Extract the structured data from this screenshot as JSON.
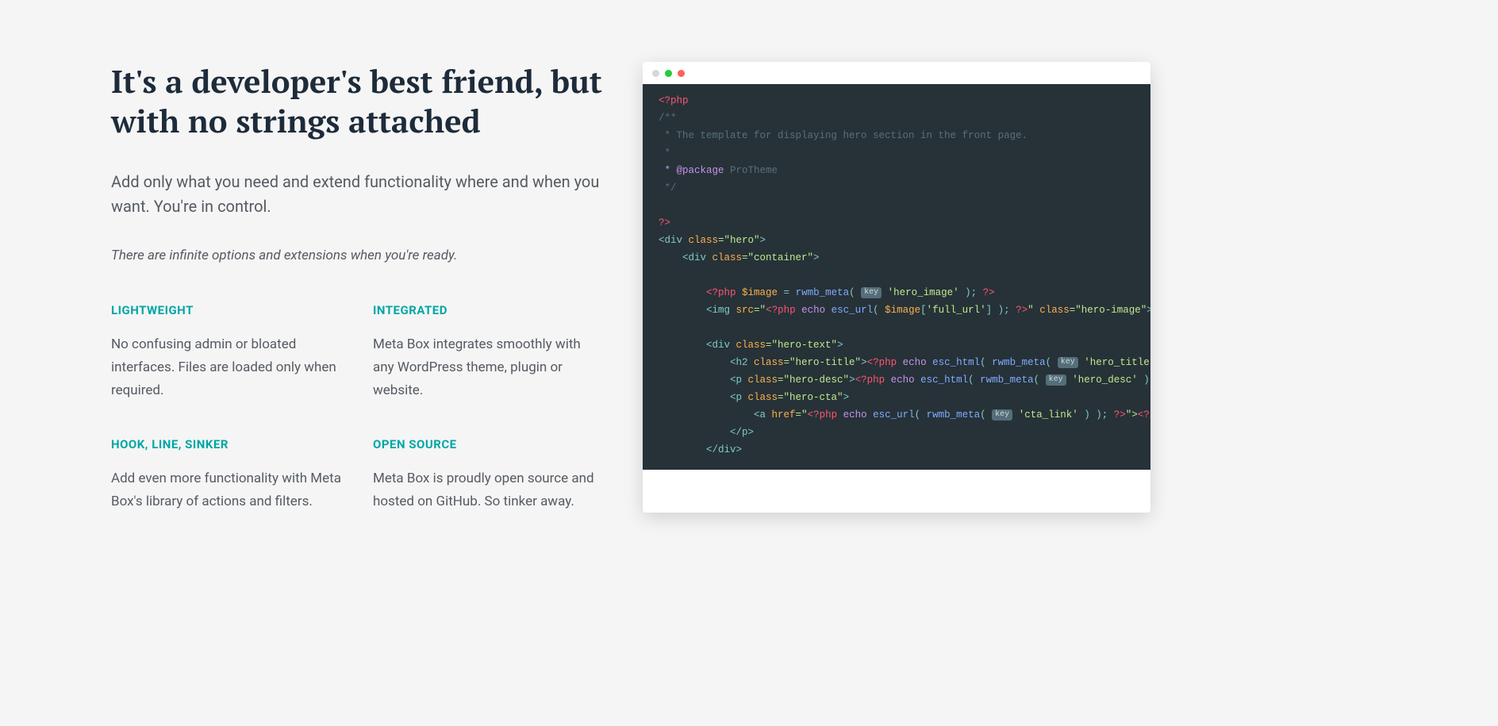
{
  "heading": "It's a developer's best friend, but with no strings attached",
  "lead": "Add only what you need and extend functionality where and when you want. You're in control.",
  "sublead": "There are infinite options and extensions when you're ready.",
  "features": [
    {
      "title": "LIGHTWEIGHT",
      "desc": "No confusing admin or bloated interfaces. Files are loaded only when required."
    },
    {
      "title": "INTEGRATED",
      "desc": "Meta Box integrates smoothly with any WordPress theme, plugin or website."
    },
    {
      "title": "HOOK, LINE, SINKER",
      "desc": "Add even more functionality with Meta Box's library of actions and filters."
    },
    {
      "title": "OPEN SOURCE",
      "desc": "Meta Box is proudly open source and hosted on GitHub. So tinker away."
    }
  ],
  "code": {
    "pill_label": "key",
    "lines": {
      "l1_open": "<?php",
      "l2": "/**",
      "l3": " * The template for displaying hero section in the front page.",
      "l4": " *",
      "l5_a": " * @package",
      "l5_b": " ProTheme",
      "l6": " */",
      "l7": "",
      "l8": "?>",
      "l9_a": "<div ",
      "l9_b": "class",
      "l9_c": "=\"hero\"",
      "l9_d": ">",
      "l10_a": "    <div ",
      "l10_b": "class",
      "l10_c": "=\"container\"",
      "l10_d": ">",
      "l11": "",
      "l12_a": "        <?php ",
      "l12_b": "$image",
      "l12_c": " = ",
      "l12_d": "rwmb_meta",
      "l12_e": "( ",
      "l12_f": "'hero_image'",
      "l12_g": " ); ",
      "l12_h": "?>",
      "l13_a": "        <img ",
      "l13_b": "src",
      "l13_c": "=\"",
      "l13_d": "<?php ",
      "l13_e": "echo ",
      "l13_f": "esc_url",
      "l13_g": "( ",
      "l13_h": "$image",
      "l13_i": "[",
      "l13_j": "'full_url'",
      "l13_k": "] ); ",
      "l13_l": "?>",
      "l13_m": "\" ",
      "l13_n": "class",
      "l13_o": "=\"hero-image\"",
      "l13_p": ">",
      "l14": "",
      "l15_a": "        <div ",
      "l15_b": "class",
      "l15_c": "=\"hero-text\"",
      "l15_d": ">",
      "l16_a": "            <h2 ",
      "l16_b": "class",
      "l16_c": "=\"hero-title\"",
      "l16_d": ">",
      "l16_e": "<?php ",
      "l16_f": "echo ",
      "l16_g": "esc_html",
      "l16_h": "( ",
      "l16_i": "rwmb_meta",
      "l16_j": "( ",
      "l16_k": "'hero_title'",
      "l17_a": "            <p ",
      "l17_b": "class",
      "l17_c": "=\"hero-desc\"",
      "l17_d": ">",
      "l17_e": "<?php ",
      "l17_f": "echo ",
      "l17_g": "esc_html",
      "l17_h": "( ",
      "l17_i": "rwmb_meta",
      "l17_j": "( ",
      "l17_k": "'hero_desc'",
      "l17_l": " ) )",
      "l18_a": "            <p ",
      "l18_b": "class",
      "l18_c": "=\"hero-cta\"",
      "l18_d": ">",
      "l19_a": "                <a ",
      "l19_b": "href",
      "l19_c": "=\"",
      "l19_d": "<?php ",
      "l19_e": "echo ",
      "l19_f": "esc_url",
      "l19_g": "( ",
      "l19_h": "rwmb_meta",
      "l19_i": "( ",
      "l19_j": "'cta_link'",
      "l19_k": " ) ); ",
      "l19_l": "?>",
      "l19_m": "\">",
      "l19_n": "<?ph",
      "l20": "            </p>",
      "l21": "        </div>"
    }
  }
}
